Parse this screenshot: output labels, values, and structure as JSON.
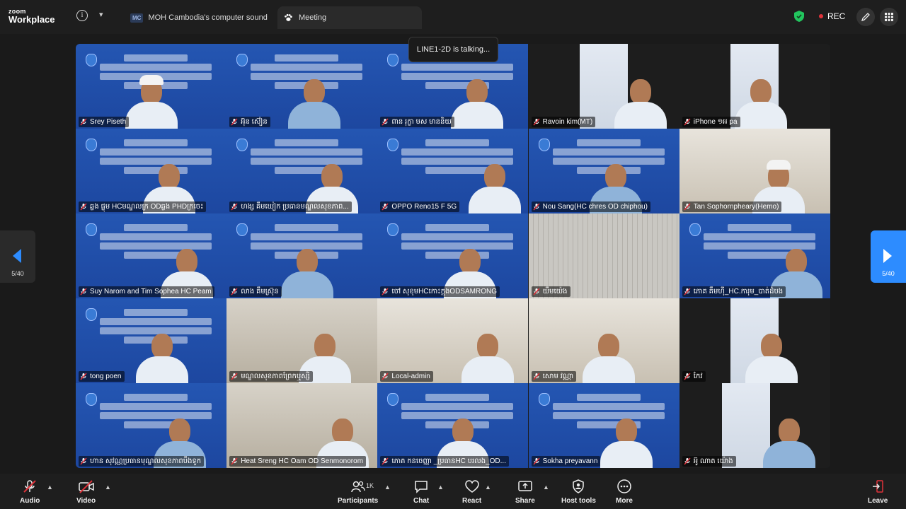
{
  "app": {
    "brand_small": "zoom",
    "brand_big": "Workplace",
    "tabs": [
      {
        "avatar": "MC",
        "label": "MOH Cambodia's computer sound"
      },
      {
        "label": "Meeting"
      }
    ],
    "rec_label": "REC"
  },
  "toast": "LINE1-2D is talking...",
  "paging": {
    "left": "5/40",
    "right": "5/40"
  },
  "participants": [
    {
      "name": "Srey Piseth"
    },
    {
      "name": "អ៊ុន ស៊ៀន"
    },
    {
      "name": "ពាន រុក្ខា មស មាននិយ"
    },
    {
      "name": "Ravoin kim(MT)"
    },
    {
      "name": "iPhone ១អ pa"
    },
    {
      "name": "ឆ្លង ផ្លុម HCមណ្ឌលក្រ ODឆ្លង PHDក្រចេះ"
    },
    {
      "name": "ហង្ស គឹមឃៀក ប្រធានមណ្ឌលសុខភាព..."
    },
    {
      "name": "OPPO Reno15 F 5G"
    },
    {
      "name": "Nou Sang(HC chres OD chiphou)"
    },
    {
      "name": "Tan Sophornpheary(Hemo)"
    },
    {
      "name": "Suy Narom and Tim Sophea HC Peam"
    },
    {
      "name": "លាង គឹមស្រ៊ុន"
    },
    {
      "name": "ចៅ សុខុមHCកោះក្ដុងODSAMRONG"
    },
    {
      "name": "យឹមយ៉េង"
    },
    {
      "name": "ភោគ គឹមហ៊ី_HC.ការុម_បាត់ដំបង"
    },
    {
      "name": "tong poen"
    },
    {
      "name": "មណ្ឌលសុខភាពព្រែកឬស្សី"
    },
    {
      "name": "Local-admin"
    },
    {
      "name": "សោម វណ្ណា"
    },
    {
      "name": "កែវ"
    },
    {
      "name": "ហាន សុវណ្ណប្រធានមុណ្ឌលសុខភាពបឹងទូក"
    },
    {
      "name": "Heat Sreng HC Oam OD Senmonorom"
    },
    {
      "name": "ភោគ កនចេញ្ញា _ប្រធានHC បរលង_OD..."
    },
    {
      "name": "Sokha preyavann"
    },
    {
      "name": "អ៊ូ ណាត យ៉ោង"
    }
  ],
  "toolbar": {
    "audio": "Audio",
    "video": "Video",
    "participants": "Participants",
    "participants_count": "1K",
    "chat": "Chat",
    "react": "React",
    "share": "Share",
    "host_tools": "Host tools",
    "more": "More",
    "leave": "Leave"
  },
  "colors": {
    "accent": "#2d8cff",
    "danger": "#e0323a",
    "secure": "#22c55e"
  }
}
